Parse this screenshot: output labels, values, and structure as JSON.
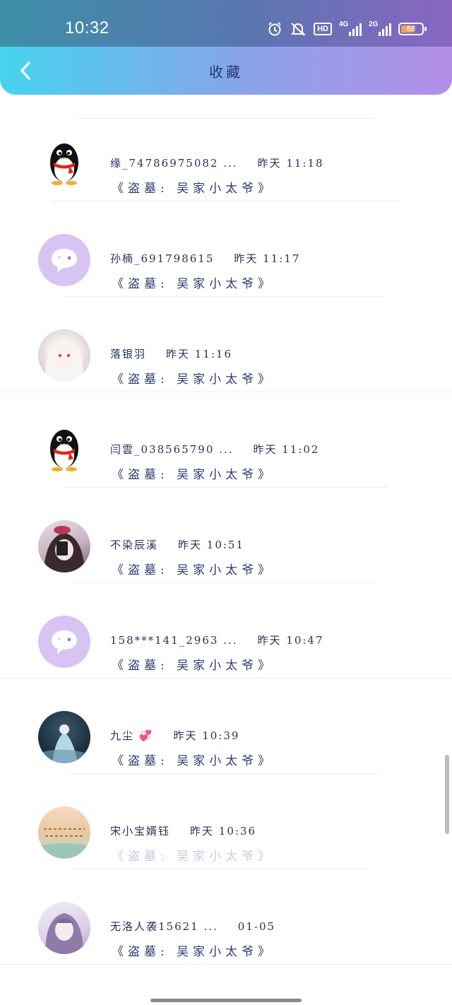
{
  "status": {
    "time": "10:32",
    "hd_label": "HD",
    "net1": "4G",
    "net2": "2G",
    "battery": "68"
  },
  "navbar": {
    "title": "收藏"
  },
  "items": [
    {
      "name": "缘_74786975082 ...",
      "time": "昨天 11:18",
      "work": "《盗墓: 吴家小太爷》",
      "avatar": "penguin-icon"
    },
    {
      "name": "孙楠_691798615",
      "time": "昨天 11:17",
      "work": "《盗墓: 吴家小太爷》",
      "avatar": "chat-bubble-icon"
    },
    {
      "name": "落银羽",
      "time": "昨天 11:16",
      "work": "《盗墓: 吴家小太爷》",
      "avatar": "photo"
    },
    {
      "name": "闫雲_038565790 ...",
      "time": "昨天 11:02",
      "work": "《盗墓: 吴家小太爷》",
      "avatar": "penguin-icon"
    },
    {
      "name": "不染辰溪",
      "time": "昨天 10:51",
      "work": "《盗墓: 吴家小太爷》",
      "avatar": "photo"
    },
    {
      "name": "158***141_2963 ...",
      "time": "昨天 10:47",
      "work": "《盗墓: 吴家小太爷》",
      "avatar": "chat-bubble-icon"
    },
    {
      "name": "九尘 💞",
      "time": "昨天 10:39",
      "work": "《盗墓: 吴家小太爷》",
      "avatar": "photo"
    },
    {
      "name": "宋小宝婿钰",
      "time": "昨天 10:36",
      "work": "《盗墓: 吴家小太爷》",
      "avatar": "photo"
    },
    {
      "name": "无洛人袭15621 ...",
      "time": "01-05",
      "work": "《盗墓: 吴家小太爷》",
      "avatar": "photo"
    }
  ]
}
